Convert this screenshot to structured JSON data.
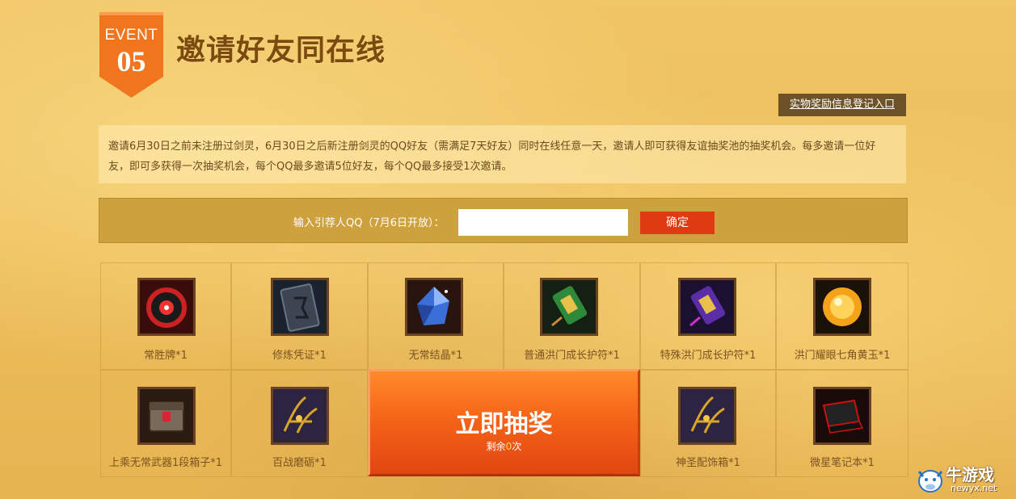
{
  "event_badge": {
    "label": "EVENT",
    "number": "05"
  },
  "page_title": "邀请好友同在线",
  "register_link": "实物奖励信息登记入口",
  "description": "邀请6月30日之前未注册过剑灵，6月30日之后新注册剑灵的QQ好友（需满足7天好友）同时在线任意一天，邀请人即可获得友谊抽奖池的抽奖机会。每多邀请一位好友，即可多获得一次抽奖机会，每个QQ最多邀请5位好友，每个QQ最多接受1次邀请。",
  "referrer": {
    "label": "输入引荐人QQ（7月6日开放）：",
    "value": "",
    "confirm_label": "确定"
  },
  "prizes": [
    {
      "name": "常胜牌*1",
      "icon": "token-icon"
    },
    {
      "name": "修炼凭证*1",
      "icon": "tablet-icon"
    },
    {
      "name": "无常结晶*1",
      "icon": "crystal-icon"
    },
    {
      "name": "普通洪门成长护符*1",
      "icon": "green-talisman-icon"
    },
    {
      "name": "特殊洪门成长护符*1",
      "icon": "purple-talisman-icon"
    },
    {
      "name": "洪门耀眼七角黄玉*1",
      "icon": "topaz-icon"
    },
    {
      "name": "上乘无常武器1段箱子*1",
      "icon": "weapon-chest-icon"
    },
    {
      "name": "百战磨砺*1",
      "icon": "gold-ornament-icon"
    },
    {
      "name": "神圣配饰箱*1",
      "icon": "gold-ornament-icon"
    },
    {
      "name": "微星笔记本*1",
      "icon": "laptop-icon"
    }
  ],
  "draw": {
    "label": "立即抽奖",
    "remaining_prefix": "剩余",
    "remaining_count": "0",
    "remaining_suffix": "次"
  },
  "watermark": {
    "brand": "牛游戏",
    "url": "newyx.net"
  },
  "colors": {
    "accent": "#e03a13",
    "badge": "#f0751d",
    "title": "#7a4a0e",
    "draw_button": "#f56519"
  }
}
